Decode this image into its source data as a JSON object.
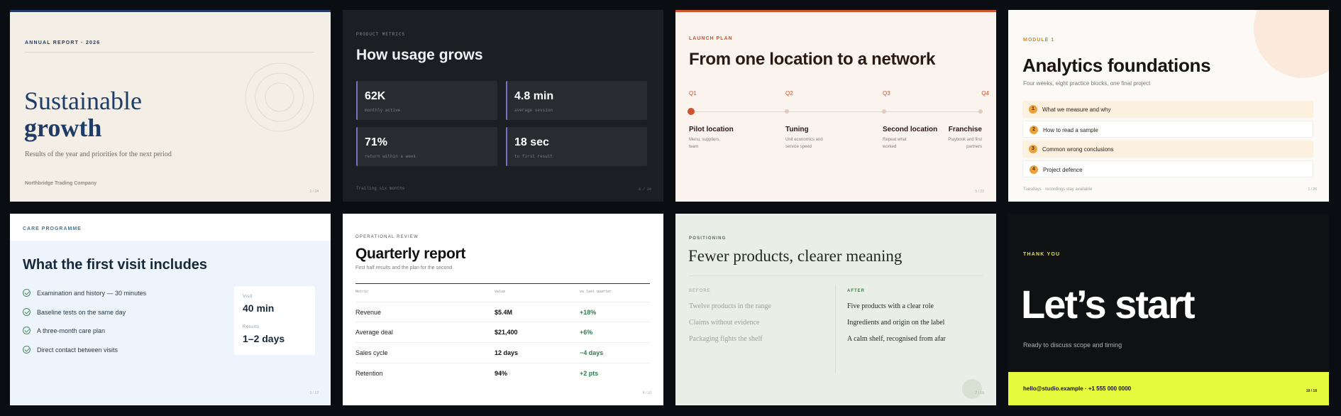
{
  "slides": [
    {
      "eyebrow": "ANNUAL REPORT · 2026",
      "title_line1": "Sustainable",
      "title_line2": "growth",
      "subtitle": "Results of the year and priorities for the next period",
      "company": "Northbridge Trading Company",
      "page": "1 / 24"
    },
    {
      "eyebrow": "PRODUCT METRICS",
      "title": "How usage grows",
      "metrics": [
        {
          "value": "62K",
          "label": "monthly active"
        },
        {
          "value": "4.8 min",
          "label": "average session"
        },
        {
          "value": "71%",
          "label": "return within a week"
        },
        {
          "value": "18 sec",
          "label": "to first result"
        }
      ],
      "footer": "Trailing six months",
      "page": "6 / 20"
    },
    {
      "eyebrow": "LAUNCH PLAN",
      "title": "From one location to a network",
      "quarters": [
        "Q1",
        "Q2",
        "Q3",
        "Q4"
      ],
      "steps": [
        {
          "title": "Pilot location",
          "desc1": "Menu, suppliers,",
          "desc2": "team"
        },
        {
          "title": "Tuning",
          "desc1": "Unit economics and",
          "desc2": "service speed"
        },
        {
          "title": "Second location",
          "desc1": "Repeat what",
          "desc2": "worked"
        },
        {
          "title": "Franchise",
          "desc1": "Playbook and first",
          "desc2": "partners"
        }
      ],
      "page": "5 / 22"
    },
    {
      "eyebrow": "MODULE 1",
      "title": "Analytics foundations",
      "subtitle": "Four weeks, eight practice blocks, one final project",
      "modules": [
        {
          "n": "1",
          "label": "What we measure and why"
        },
        {
          "n": "2",
          "label": "How to read a sample"
        },
        {
          "n": "3",
          "label": "Common wrong conclusions"
        },
        {
          "n": "4",
          "label": "Project defence"
        }
      ],
      "footer": "Tuesdays · recordings stay available",
      "page": "1 / 20"
    },
    {
      "eyebrow": "CARE PROGRAMME",
      "title": "What the first visit includes",
      "items": [
        "Examination and history — 30 minutes",
        "Baseline tests on the same day",
        "A three-month care plan",
        "Direct contact between visits"
      ],
      "visit_label": "Visit",
      "visit_value": "40 min",
      "results_label": "Results",
      "results_value": "1–2 days",
      "page": "3 / 12"
    },
    {
      "eyebrow": "OPERATIONAL REVIEW",
      "title": "Quarterly report",
      "subtitle": "First half results and the plan for the second",
      "headers": [
        "Metric",
        "Value",
        "vs last quarter"
      ],
      "rows": [
        [
          "Revenue",
          "$5.4M",
          "+18%"
        ],
        [
          "Average deal",
          "$21,400",
          "+6%"
        ],
        [
          "Sales cycle",
          "12 days",
          "−4 days"
        ],
        [
          "Retention",
          "94%",
          "+2 pts"
        ]
      ],
      "page": "4 / 16"
    },
    {
      "eyebrow": "POSITIONING",
      "title": "Fewer products, clearer meaning",
      "before_label": "BEFORE",
      "after_label": "AFTER",
      "before": [
        "Twelve products in the range",
        "Claims without evidence",
        "Packaging fights the shelf"
      ],
      "after": [
        "Five products with a clear role",
        "Ingredients and origin on the label",
        "A calm shelf, recognised from afar"
      ],
      "page": "7 / 18"
    },
    {
      "eyebrow": "THANK YOU",
      "title": "Let’s start",
      "subtitle": "Ready to discuss scope and timing",
      "contact": "hello@studio.example · +1 555 000 0000",
      "page": "18 / 18"
    }
  ],
  "colors": {
    "navy": "#1f3c66",
    "orange": "#d0532e",
    "purple": "#7a72c9",
    "amber": "#e9a33a",
    "green": "#2e7d4f",
    "lime": "#e6fa3e"
  }
}
